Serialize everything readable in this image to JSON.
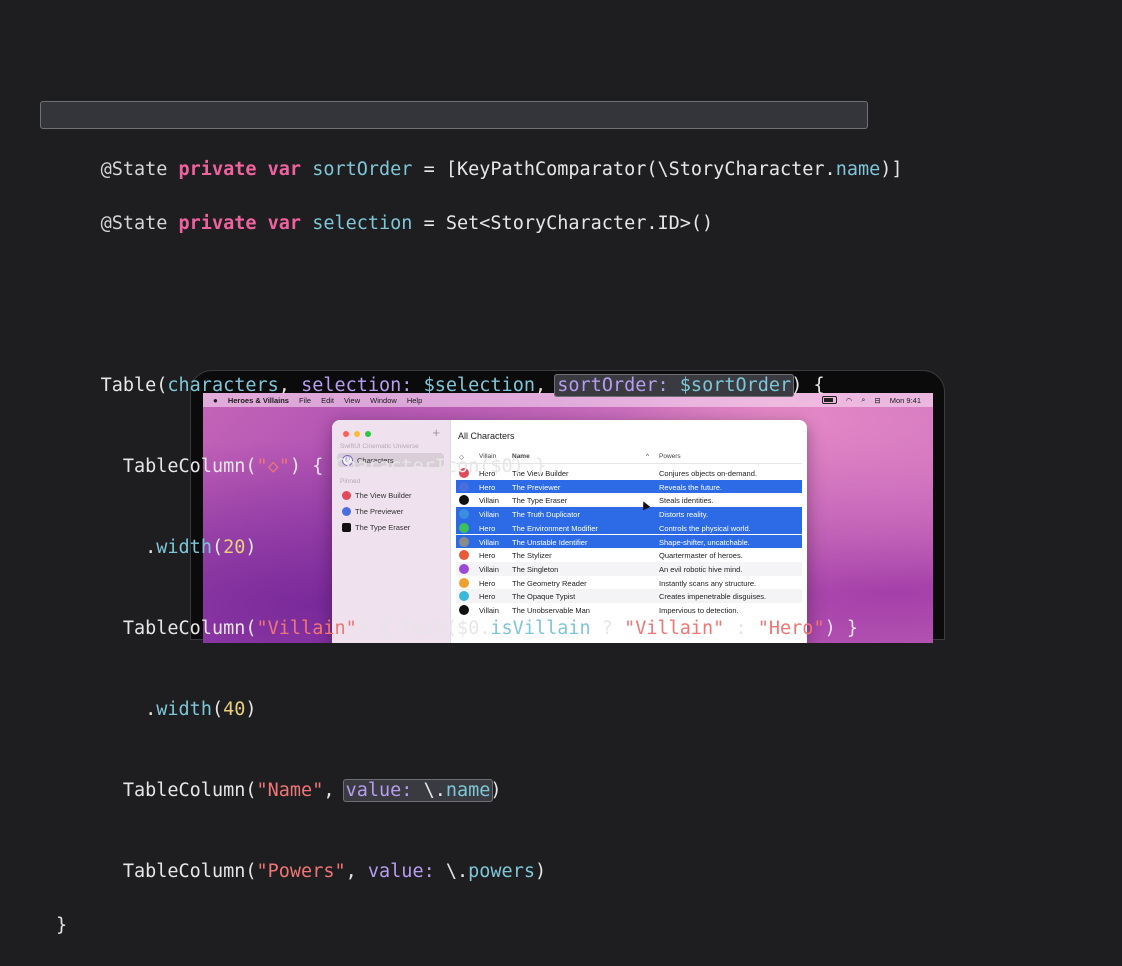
{
  "code": {
    "line1": {
      "a": "@State ",
      "kw1": "private",
      "sp1": " ",
      "kw2": "var",
      "sp2": " ",
      "id": "sortOrder",
      "b": " = [KeyPathComparator(\\StoryCharacter.",
      "mem": "name",
      "c": ")]"
    },
    "line2": {
      "a": "@State ",
      "kw1": "private",
      "sp1": " ",
      "kw2": "var",
      "sp2": " ",
      "id": "selection",
      "b": " = Set<StoryCharacter.ID>()"
    },
    "line4": {
      "a": "Table(",
      "p1": "characters",
      "b": ", ",
      "p2": "selection:",
      "c": " ",
      "p3": "$selection",
      "d": ", ",
      "hl1": "sortOrder:",
      "hl2": " ",
      "hl3": "$sortOrder",
      "e": ") {"
    },
    "line5": {
      "a": "  TableColumn(",
      "s": "\"◇\"",
      "b": ") { CharacterIcon($0) }"
    },
    "line6": {
      "a": "    .",
      "m": "width",
      "b": "(",
      "n": "20",
      "c": ")"
    },
    "line7": {
      "a": "  TableColumn(",
      "s": "\"Villain\"",
      "b": ") { Text($0.",
      "m": "isVillain",
      "c": " ? ",
      "s2": "\"Villain\"",
      "d": " : ",
      "s3": "\"Hero\"",
      "e": ") }"
    },
    "line8": {
      "a": "    .",
      "m": "width",
      "b": "(",
      "n": "40",
      "c": ")"
    },
    "line9": {
      "a": "  TableColumn(",
      "s": "\"Name\"",
      "b": ", ",
      "hl1": "value:",
      "hl2": " \\.",
      "hl3": "name",
      "c": ")"
    },
    "line10": {
      "a": "  TableColumn(",
      "s": "\"Powers\"",
      "b": ", ",
      "p": "value:",
      "c": " \\.",
      "m": "powers",
      "d": ")"
    },
    "line11": "}"
  },
  "menubar": {
    "apple": "",
    "app": "Heroes & Villains",
    "items": [
      "File",
      "Edit",
      "View",
      "Window",
      "Help"
    ],
    "time": "Mon 9:41"
  },
  "sidebar": {
    "section1": "SwiftUI Cinematic Universe",
    "characters": "Characters",
    "section2": "Pinned",
    "pinned": [
      "The View Builder",
      "The Previewer",
      "The Type Eraser"
    ]
  },
  "main": {
    "title": "All Characters",
    "headers": {
      "icon": "◇",
      "villain": "Villain",
      "name": "Name",
      "sort": "^",
      "powers": "Powers"
    },
    "rows": [
      {
        "type": "Hero",
        "name": "The View Builder",
        "power": "Conjures objects on-demand.",
        "color": "#e04a5a",
        "selected": false
      },
      {
        "type": "Hero",
        "name": "The Previewer",
        "power": "Reveals the future.",
        "color": "#4a6de0",
        "selected": true
      },
      {
        "type": "Villain",
        "name": "The Type Eraser",
        "power": "Steals identities.",
        "color": "#111111",
        "selected": false
      },
      {
        "type": "Villain",
        "name": "The Truth Duplicator",
        "power": "Distorts reality.",
        "color": "#3a8ee0",
        "selected": true
      },
      {
        "type": "Hero",
        "name": "The Environment Modifier",
        "power": "Controls the physical world.",
        "color": "#3cc05a",
        "selected": true
      },
      {
        "type": "Villain",
        "name": "The Unstable Identifier",
        "power": "Shape-shifter, uncatchable.",
        "color": "#8b8b8b",
        "selected": true
      },
      {
        "type": "Hero",
        "name": "The Stylizer",
        "power": "Quartermaster of heroes.",
        "color": "#e85a3a",
        "selected": false
      },
      {
        "type": "Villain",
        "name": "The Singleton",
        "power": "An evil robotic hive mind.",
        "color": "#9b4ad8",
        "selected": false
      },
      {
        "type": "Hero",
        "name": "The Geometry Reader",
        "power": "Instantly scans any structure.",
        "color": "#f0a030",
        "selected": false
      },
      {
        "type": "Hero",
        "name": "The Opaque Typist",
        "power": "Creates impenetrable disguises.",
        "color": "#3ab8d8",
        "selected": false
      },
      {
        "type": "Villain",
        "name": "The Unobservable Man",
        "power": "Impervious to detection.",
        "color": "#111111",
        "selected": false
      }
    ]
  }
}
